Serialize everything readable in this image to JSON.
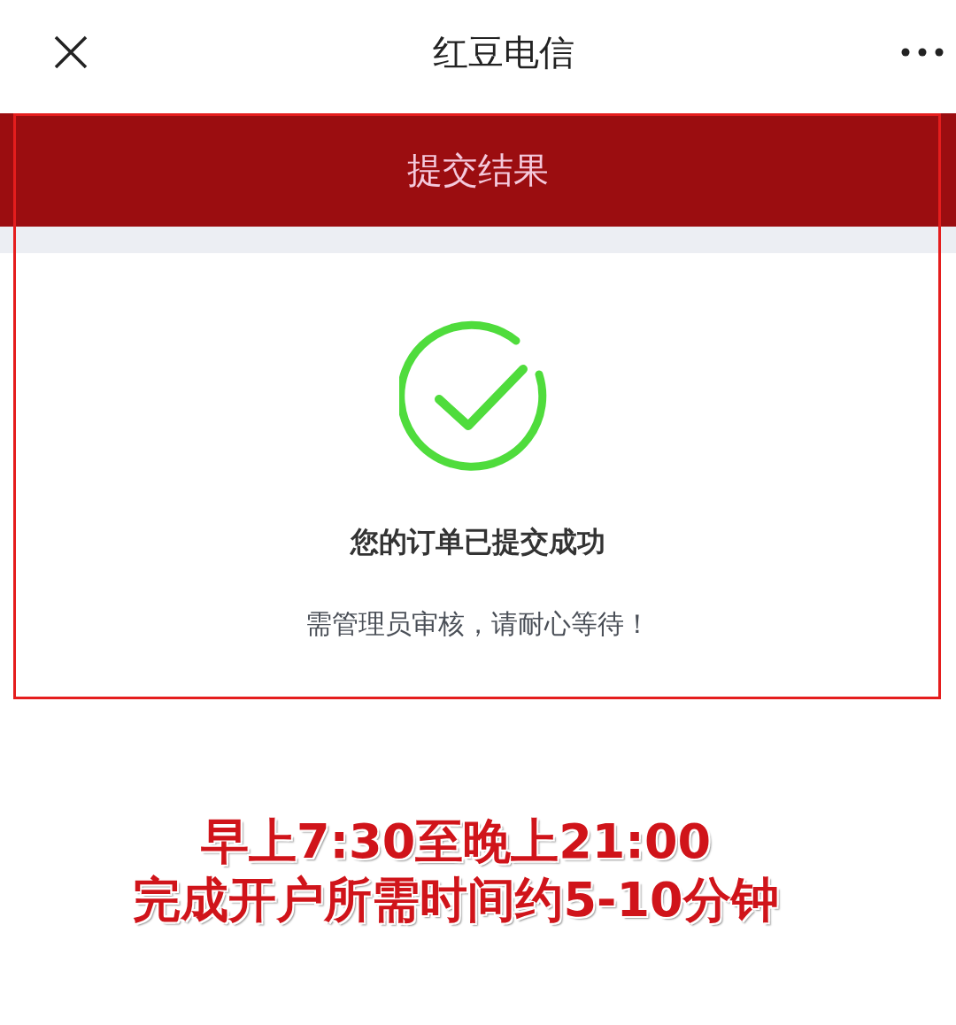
{
  "header": {
    "title": "红豆电信"
  },
  "banner": {
    "title": "提交结果"
  },
  "result": {
    "message": "您的订单已提交成功",
    "note": "需管理员审核，请耐心等待！"
  },
  "annotation": {
    "highlight_frame": true,
    "lines": [
      "早上7:30至晚上21:00",
      "完成开户所需时间约5-10分钟"
    ]
  }
}
